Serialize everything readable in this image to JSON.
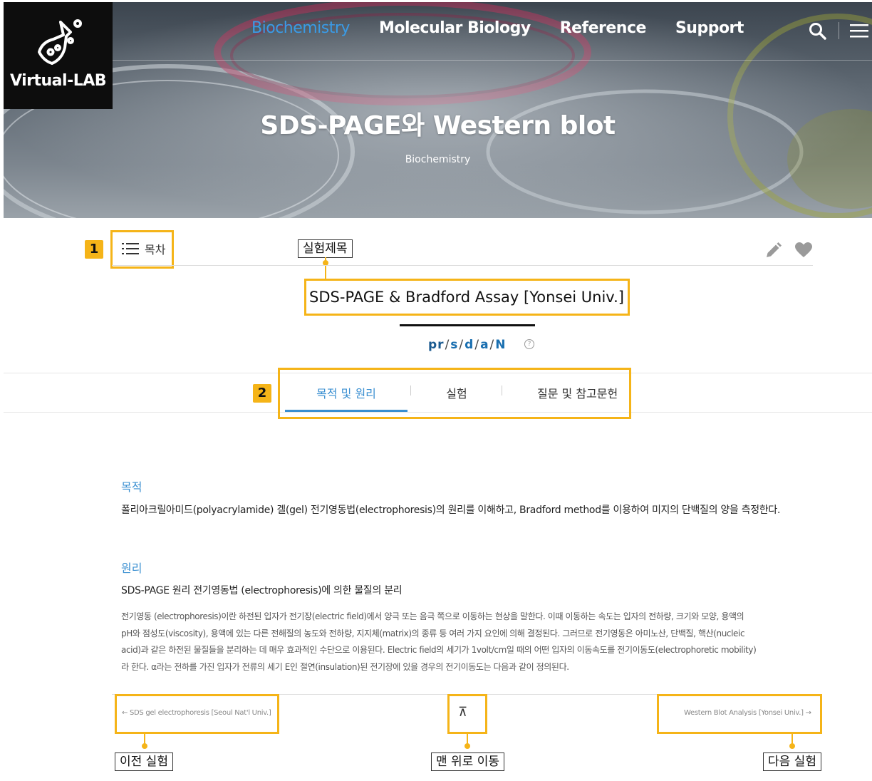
{
  "header": {
    "logo_text": "Virtual-LAB",
    "nav": [
      {
        "label": "Biochemistry",
        "active": true
      },
      {
        "label": "Molecular Biology",
        "active": false
      },
      {
        "label": "Reference",
        "active": false
      },
      {
        "label": "Support",
        "active": false
      }
    ],
    "page_title": "SDS-PAGE와 Western blot",
    "category": "Biochemistry"
  },
  "toolbar": {
    "toc_label": "목차"
  },
  "experiment": {
    "title": "SDS-PAGE & Bradford Assay [Yonsei Univ.]",
    "codes": [
      "pr",
      "s",
      "d",
      "a",
      "N"
    ],
    "help_glyph": "?"
  },
  "tabs": [
    {
      "label": "목적 및 원리",
      "active": true
    },
    {
      "label": "실험",
      "active": false
    },
    {
      "label": "질문 및 참고문헌",
      "active": false
    }
  ],
  "content": {
    "purpose_heading": "목적",
    "purpose_text": "폴리아크릴아미드(polyacrylamide) 겔(gel) 전기영동법(electrophoresis)의 원리를 이해하고, Bradford method를 이용하여 미지의 단백질의 양을 측정한다.",
    "principle_heading": "원리",
    "principle_subheading": "SDS-PAGE 원리 전기영동법 (electrophoresis)에 의한 물질의 분리",
    "principle_lines": [
      "전기영동 (electrophoresis)이란 하전된 입자가 전기장(electric field)에서 양극 또는 음극 쪽으로 이동하는 현상을 말한다. 이때 이동하는 속도는 입자의 전하량, 크기와 모양, 용액의",
      "pH와 점성도(viscosity), 용액에 있는 다른 전해질의 농도와 전하량, 지지체(matrix)의 종류 등 여러 가지 요인에 의해 결정된다. 그러므로 전기영동은 아미노산, 단백질, 핵산(nucleic",
      "acid)과 같은 하전된 물질들을 분리하는 데 매우 효과적인 수단으로 이용된다. Electric field의 세기가 1volt/cm일 때의 어떤 입자의 이동속도를 전기이동도(electrophoretic mobility)",
      "라 한다. α라는 전하를 가진 입자가 전류의 세기 E인 절연(insulation)된 전기장에 있을 경우의 전기이동도는 다음과 같이 정의된다."
    ]
  },
  "pager": {
    "prev": "← SDS gel electrophoresis [Seoul Nat'l Univ.]",
    "top_glyph": "⊼",
    "next": "Western Blot Analysis [Yonsei Univ.] →"
  },
  "annotations": {
    "badge_1": "1",
    "badge_2": "2",
    "exp_title_label": "실험제목",
    "prev_label": "이전 실험",
    "top_label": "맨 위로 이동",
    "next_label": "다음 실험",
    "color": "#f5b418"
  },
  "colors": {
    "accent": "#3a8fd1",
    "nav_active": "#3a9be6",
    "logo_bg": "#0d0d0d"
  }
}
